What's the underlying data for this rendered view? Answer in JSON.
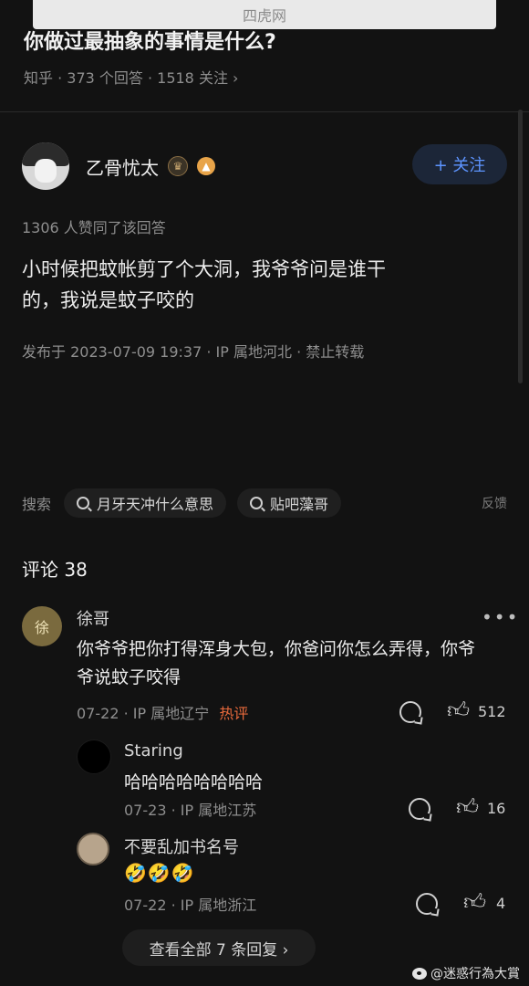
{
  "watermark": "四虎网",
  "question": {
    "title": "你做过最抽象的事情是什么?",
    "meta": "知乎 · 373 个回答 · 1518 关注 ›"
  },
  "author": {
    "name": "乙骨忧太",
    "follow_label": "+ 关注",
    "badge1_icon": "crown-badge-icon",
    "badge2_icon": "medal-badge-icon"
  },
  "answer": {
    "upvotes": "1306 人赞同了该回答",
    "lines": [
      "小时候把蚊帐剪了个大洞，我爷爷问是谁干",
      "的，我说是蚊子咬的"
    ],
    "meta": "发布于 2023-07-09 19:37 · IP 属地河北 · 禁止转载"
  },
  "search": {
    "label": "搜索",
    "chips": [
      "月牙天冲什么意思",
      "贴吧藻哥"
    ],
    "feedback": "反馈"
  },
  "comments": {
    "heading": "评论 38",
    "items": [
      {
        "name": "徐哥",
        "avatar_text": "徐",
        "text": "你爷爷把你打得浑身大包，你爸问你怎么弄得，你爷爷说蚊子咬得",
        "meta": "07-22 · IP 属地辽宁",
        "hot": "热评",
        "likes": "512"
      },
      {
        "name": "Staring",
        "text": "哈哈哈哈哈哈哈哈",
        "meta": "07-23 · IP 属地江苏",
        "likes": "16"
      },
      {
        "name": "不要乱加书名号",
        "text": "🤣🤣🤣",
        "meta": "07-22 · IP 属地浙江",
        "likes": "4"
      }
    ],
    "view_all": "查看全部 7 条回复 ›"
  },
  "footer_watermark": "@迷惑行為大賞",
  "colors": {
    "background": "#121212",
    "accent_blue": "#5d94ff",
    "hot_orange": "#e96a3c"
  }
}
